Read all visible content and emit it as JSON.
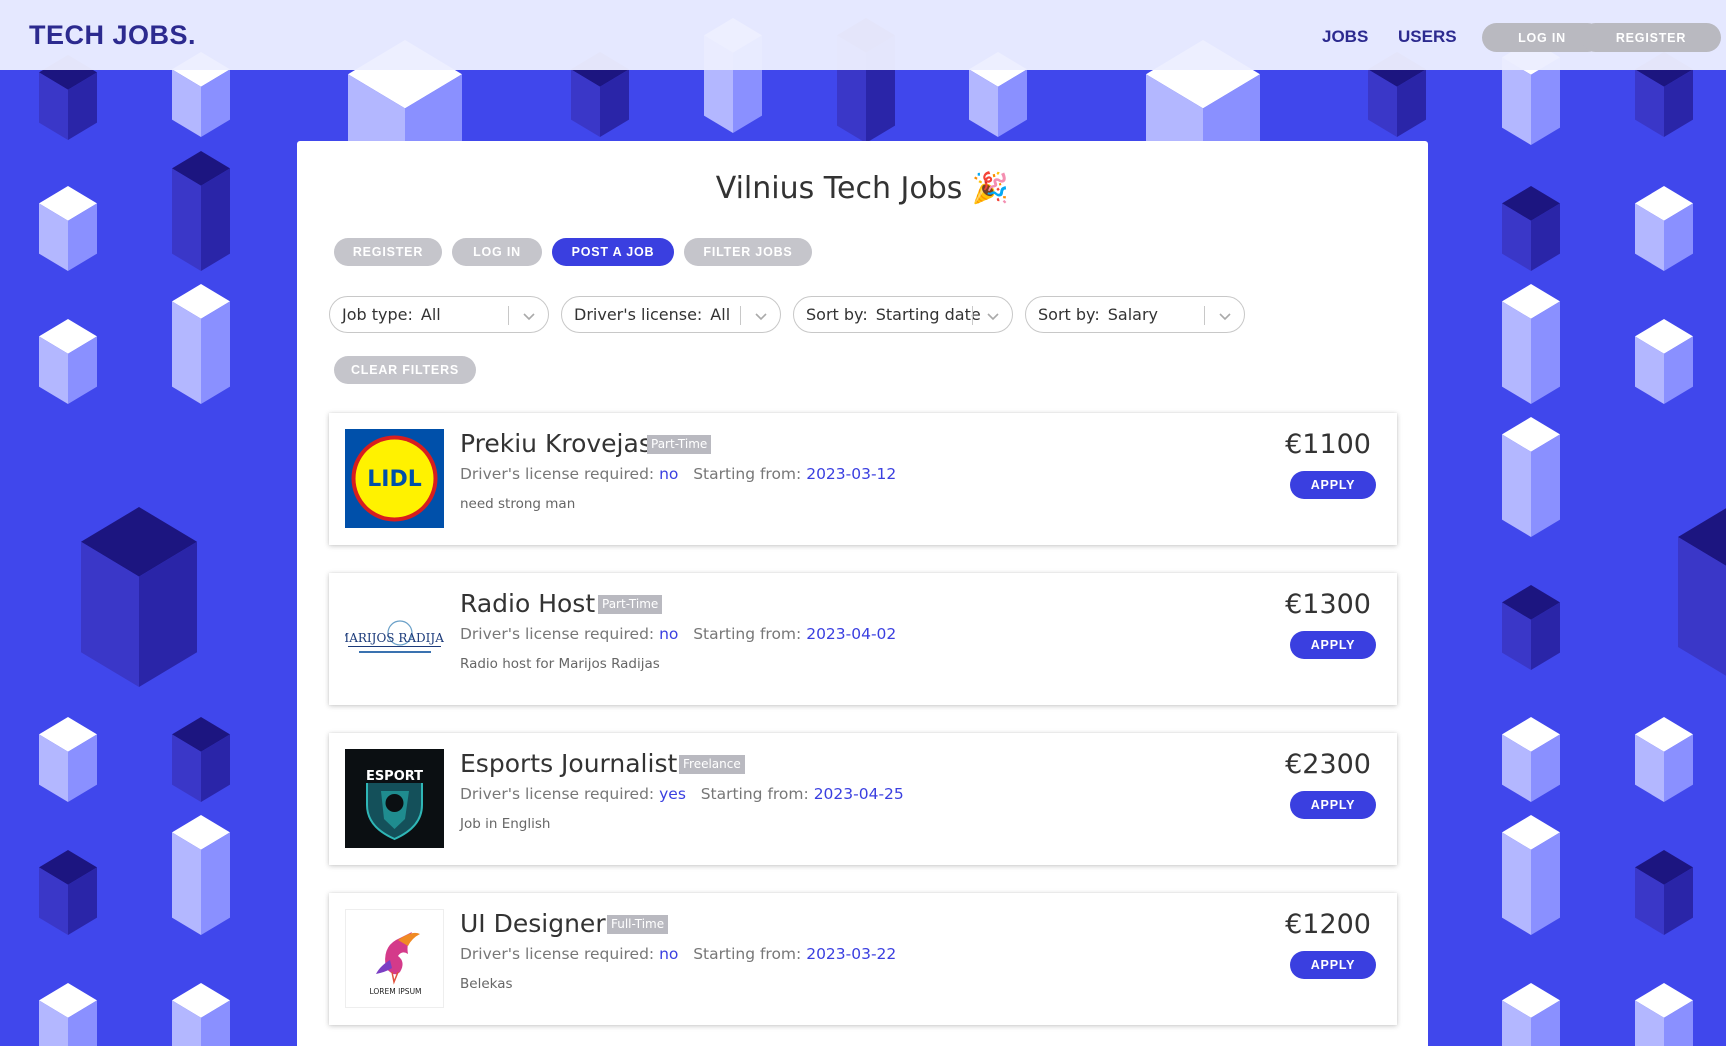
{
  "navbar": {
    "brand": "TECH JOBS.",
    "links": [
      "JOBS",
      "USERS"
    ],
    "login_label": "LOG IN",
    "register_label": "REGISTER"
  },
  "page": {
    "title": "Vilnius Tech Jobs 🎉"
  },
  "actions": {
    "register_label": "REGISTER",
    "login_label": "LOG IN",
    "post_job_label": "POST A JOB",
    "filter_jobs_label": "FILTER JOBS"
  },
  "filters": [
    {
      "label": "Job type:",
      "value": "All"
    },
    {
      "label": "Driver's license:",
      "value": "All"
    },
    {
      "label": "Sort by:",
      "value": "Starting date"
    },
    {
      "label": "Sort by:",
      "value": "Salary"
    }
  ],
  "clear_filters_label": "CLEAR FILTERS",
  "job_meta_labels": {
    "license": "Driver's license required:",
    "starting": "Starting from:"
  },
  "apply_label": "APPLY",
  "jobs": [
    {
      "title": "Prekiu Krovejas",
      "type": "Part-Time",
      "license": "no",
      "start": "2023-03-12",
      "description": "need strong man",
      "salary": "€1100",
      "logo": "LIDL"
    },
    {
      "title": "Radio Host",
      "type": "Part-Time",
      "license": "no",
      "start": "2023-04-02",
      "description": "Radio host for Marijos Radijas",
      "salary": "€1300",
      "logo": "MARIJOS RADIJAS"
    },
    {
      "title": "Esports Journalist",
      "type": "Freelance",
      "license": "yes",
      "start": "2023-04-25",
      "description": "Job in English",
      "salary": "€2300",
      "logo": "ESPORT"
    },
    {
      "title": "UI Designer",
      "type": "Full-Time",
      "license": "no",
      "start": "2023-03-22",
      "description": "Belekas",
      "salary": "€1200",
      "logo": "LOREM IPSUM"
    }
  ],
  "colors": {
    "background": "#4047ec",
    "accent": "#3a3fe0",
    "brand_text": "#2c2a8f",
    "muted_button": "#b9b9c0"
  }
}
